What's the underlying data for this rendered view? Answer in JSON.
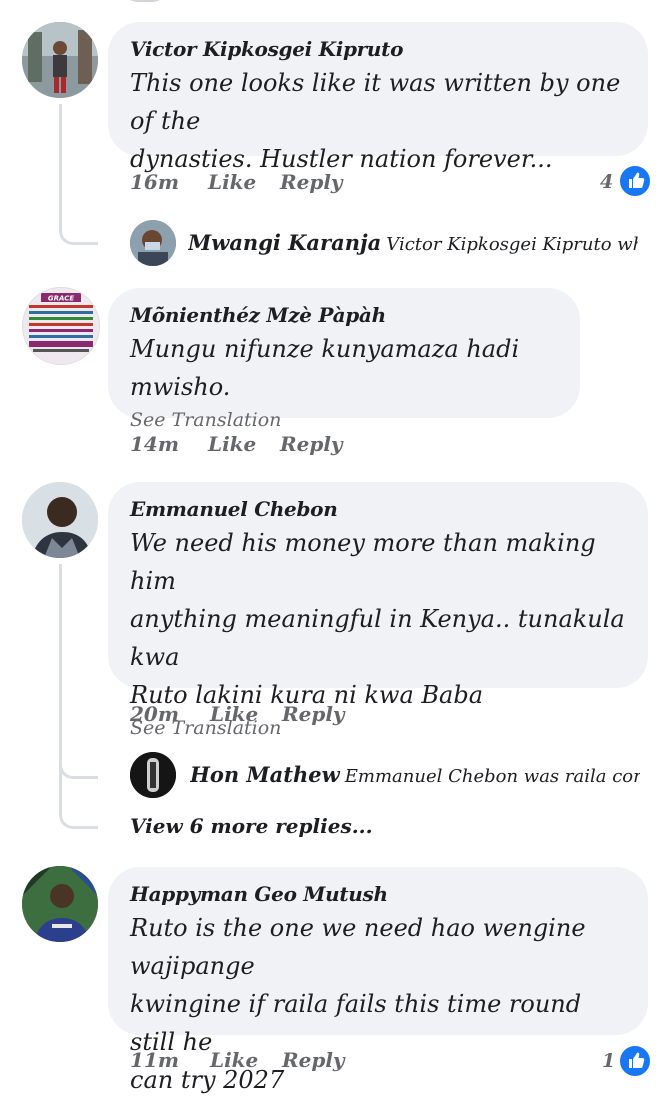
{
  "colors": {
    "accent": "#1877f2",
    "bubble": "#f0f2f5",
    "meta": "#65676b"
  },
  "comments": [
    {
      "author": "Victor Kipkosgei Kipruto",
      "text_lines": [
        "This one looks like it was written by one of the",
        "dynasties. Hustler nation forever..."
      ],
      "time": "16m",
      "like": "Like",
      "reply": "Reply",
      "reaction_count": "4",
      "reply_preview": {
        "author": "Mwangi Karanja",
        "text": "Victor Kipkosgei Kipruto where..."
      }
    },
    {
      "author": "Mõnienthéz Mzè Pàpàh",
      "text_lines": [
        "Mungu nifunze kunyamaza hadi mwisho."
      ],
      "see_translation": "See Translation",
      "time": "14m",
      "like": "Like",
      "reply": "Reply"
    },
    {
      "author": "Emmanuel Chebon",
      "text_lines": [
        "We need his money more than making him",
        "anything meaningful in Kenya.. tunakula kwa",
        "Ruto lakini kura ni kwa Baba"
      ],
      "see_translation": "See Translation",
      "time": "20m",
      "like": "Like",
      "reply": "Reply",
      "reply_preview": {
        "author": "Hon Mathew",
        "text": "Emmanuel Chebon was raila contesti..."
      },
      "view_more": "View 6 more replies..."
    },
    {
      "author": "Happyman Geo Mutush",
      "text_lines": [
        "Ruto is the one we need hao wengine wajipange",
        "kwingine if raila fails this time round still he",
        "can try 2027"
      ],
      "time": "11m",
      "like": "Like",
      "reply": "Reply",
      "reaction_count": "1"
    }
  ],
  "avatar_sign": {
    "lines": [
      "GRACE",
      "Lies are believed",
      "Protocols become useless",
      "Connections become useless",
      "Powers become silent",
      "Condemnation is reversed",
      "Hopelessness is defeated",
      "GRACE SPEAK on YOUR",
      "BEHALF TODAY AND ALWAYS"
    ]
  }
}
